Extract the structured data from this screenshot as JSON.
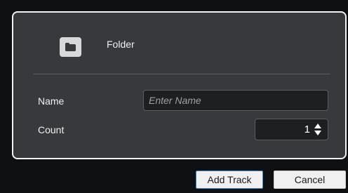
{
  "dialog": {
    "track_type": {
      "icon": "folder-icon",
      "label": "Folder"
    },
    "name": {
      "label": "Name",
      "value": "",
      "placeholder": "Enter Name"
    },
    "count": {
      "label": "Count",
      "value": "1"
    },
    "buttons": {
      "add_track": "Add Track",
      "cancel": "Cancel"
    }
  },
  "colors": {
    "panel_background": "#37393c",
    "panel_border": "#f2f2f2",
    "input_background": "#1e1f21",
    "default_button_border": "#3c8ad8"
  }
}
